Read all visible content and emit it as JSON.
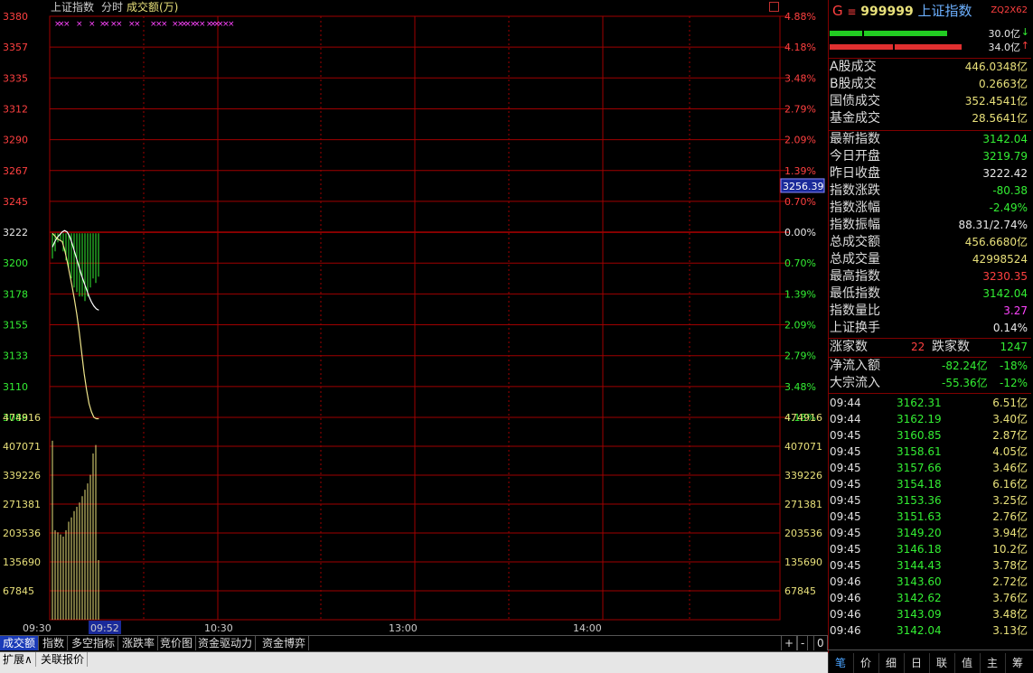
{
  "header": {
    "index_name": "上证指数",
    "mode": "分时",
    "volume_label": "成交额(万)",
    "corner_icon": "square-icon"
  },
  "chart_data": [
    {
      "type": "line",
      "name": "price",
      "ylim": [
        3088,
        3380
      ],
      "y_ticks_left": [
        "3380",
        "3357",
        "3335",
        "3312",
        "3290",
        "3267",
        "3245",
        "3222",
        "3200",
        "3178",
        "3155",
        "3133",
        "3110",
        "3088"
      ],
      "y_ticks_right": [
        "4.88%",
        "4.18%",
        "3.48%",
        "2.79%",
        "2.09%",
        "1.39%",
        "0.70%",
        "0.00%",
        "0.70%",
        "1.39%",
        "2.09%",
        "2.79%",
        "3.48%",
        "4.18%"
      ],
      "prev_close": 3222.42,
      "cursor_value": "3256.39",
      "x_ticks": [
        "09:30",
        "09:52",
        "10:30",
        "13:00",
        "14:00"
      ],
      "series": [
        {
          "values": [
            3212,
            3216,
            3219,
            3221,
            3223,
            3224,
            3223,
            3220,
            3215,
            3209,
            3203,
            3197,
            3191,
            3186,
            3181,
            3176,
            3172,
            3169,
            3167,
            3166
          ]
        },
        {
          "values": [
            3222,
            3220,
            3218,
            3217,
            3216,
            3210,
            3202,
            3193,
            3184,
            3174,
            3163,
            3150,
            3135,
            3120,
            3108,
            3098,
            3092,
            3088,
            3087,
            3087
          ]
        }
      ]
    },
    {
      "type": "bar",
      "name": "volume",
      "ylim": [
        0,
        474916
      ],
      "y_ticks": [
        "474916",
        "407071",
        "339226",
        "271381",
        "203536",
        "135690",
        "67845"
      ],
      "values": [
        420000,
        210000,
        205000,
        200000,
        195000,
        210000,
        230000,
        240000,
        255000,
        265000,
        275000,
        290000,
        305000,
        320000,
        340000,
        390000,
        410000,
        140000
      ]
    }
  ],
  "panel": {
    "code_prefix": "G",
    "code": "999999",
    "name": "上证指数",
    "tag": "ZQ2X62",
    "bar1_value": "30.0亿",
    "bar2_value": "34.0亿",
    "turnover": [
      {
        "k": "A股成交",
        "v": "446.0348亿"
      },
      {
        "k": "B股成交",
        "v": "0.2663亿"
      },
      {
        "k": "国债成交",
        "v": "352.4541亿"
      },
      {
        "k": "基金成交",
        "v": "28.5641亿"
      }
    ],
    "stats": [
      {
        "k": "最新指数",
        "v": "3142.04",
        "c": "c-grn"
      },
      {
        "k": "今日开盘",
        "v": "3219.79",
        "c": "c-grn"
      },
      {
        "k": "昨日收盘",
        "v": "3222.42",
        "c": "c-wht"
      },
      {
        "k": "指数涨跌",
        "v": "-80.38",
        "c": "c-grn"
      },
      {
        "k": "指数涨幅",
        "v": "-2.49%",
        "c": "c-grn"
      },
      {
        "k": "指数振幅",
        "v": "88.31/2.74%",
        "c": "c-wht"
      },
      {
        "k": "总成交额",
        "v": "456.6680亿",
        "c": "c-yel"
      },
      {
        "k": "总成交量",
        "v": "42998524",
        "c": "c-yel"
      },
      {
        "k": "最高指数",
        "v": "3230.35",
        "c": "c-red"
      },
      {
        "k": "最低指数",
        "v": "3142.04",
        "c": "c-grn"
      },
      {
        "k": "指数量比",
        "v": "3.27",
        "c": "c-mag"
      },
      {
        "k": "上证换手",
        "v": "0.14%",
        "c": "c-wht"
      }
    ],
    "up_label": "涨家数",
    "up_count": "22",
    "down_label": "跌家数",
    "down_count": "1247",
    "flow": [
      {
        "k": "净流入额",
        "v": "-82.24亿",
        "p": "-18%"
      },
      {
        "k": "大宗流入",
        "v": "-55.36亿",
        "p": "-12%"
      }
    ],
    "ticks": [
      {
        "t": "09:44",
        "p": "3162.31",
        "a": "6.51亿"
      },
      {
        "t": "09:44",
        "p": "3162.19",
        "a": "3.40亿"
      },
      {
        "t": "09:45",
        "p": "3160.85",
        "a": "2.87亿"
      },
      {
        "t": "09:45",
        "p": "3158.61",
        "a": "4.05亿"
      },
      {
        "t": "09:45",
        "p": "3157.66",
        "a": "3.46亿"
      },
      {
        "t": "09:45",
        "p": "3154.18",
        "a": "6.16亿"
      },
      {
        "t": "09:45",
        "p": "3153.36",
        "a": "3.25亿"
      },
      {
        "t": "09:45",
        "p": "3151.63",
        "a": "2.76亿"
      },
      {
        "t": "09:45",
        "p": "3149.20",
        "a": "3.94亿"
      },
      {
        "t": "09:45",
        "p": "3146.18",
        "a": "10.2亿"
      },
      {
        "t": "09:45",
        "p": "3144.43",
        "a": "3.78亿"
      },
      {
        "t": "09:46",
        "p": "3143.60",
        "a": "2.72亿"
      },
      {
        "t": "09:46",
        "p": "3142.62",
        "a": "3.76亿"
      },
      {
        "t": "09:46",
        "p": "3143.09",
        "a": "3.48亿"
      },
      {
        "t": "09:46",
        "p": "3142.04",
        "a": "3.13亿"
      }
    ],
    "tabs": [
      "笔",
      "价",
      "细",
      "日",
      "联",
      "值",
      "主",
      "筹"
    ]
  },
  "bottom_tabs": [
    "成交额",
    "指数",
    "多空指标",
    "涨跌率",
    "竞价图",
    "资金驱动力",
    "资金博弈"
  ],
  "bottom_controls": [
    "+",
    "-",
    "0"
  ],
  "footer_tabs": [
    "扩展∧",
    "关联报价"
  ],
  "colors": {
    "grid": "#a00000",
    "up": "#ff4040",
    "down": "#33ee33",
    "volume": "#e8e07a"
  }
}
